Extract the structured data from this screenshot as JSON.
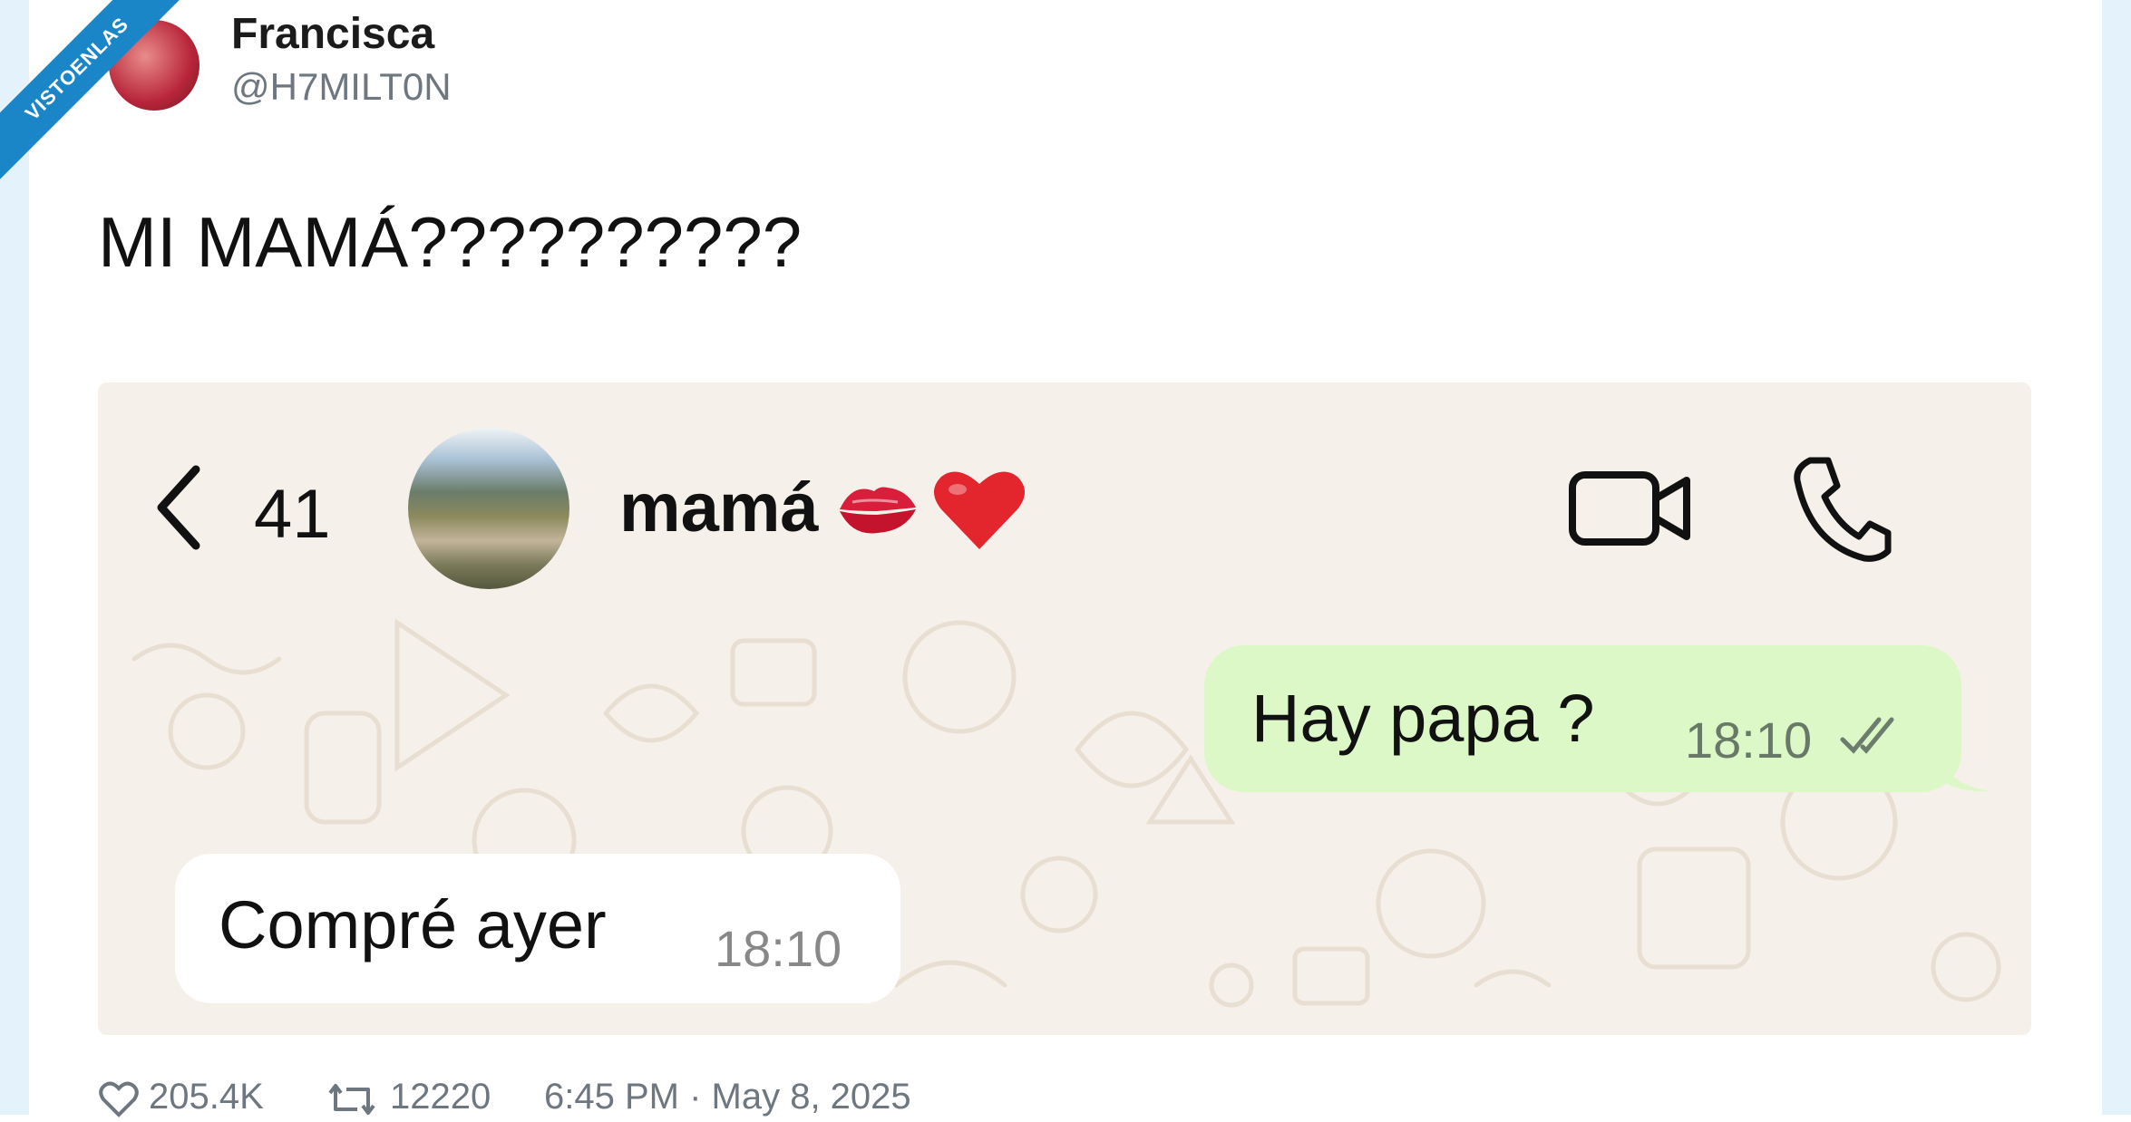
{
  "watermark": "VISTOENLAS",
  "tweet": {
    "author_name": "Francisca",
    "author_handle": "@H7MILT0N",
    "text": "MI MAMÁ??????????"
  },
  "chat": {
    "back_count": "41",
    "contact_name": "mamá",
    "messages": [
      {
        "direction": "outgoing",
        "text": "Hay papa ?",
        "time": "18:10",
        "status": "read"
      },
      {
        "direction": "incoming",
        "text": "Compré ayer",
        "time": "18:10"
      }
    ]
  },
  "footer": {
    "likes": "205.4K",
    "retweets": "12220",
    "timestamp": "6:45 PM · May 8, 2025"
  },
  "colors": {
    "watermark": "#1a86c8",
    "chat_background": "#f5f1ea",
    "outgoing_bubble": "#dcf8c6",
    "incoming_bubble": "#ffffff"
  },
  "icons": [
    "heart-outline-icon",
    "retweet-icon",
    "back-chevron-icon",
    "video-call-icon",
    "phone-icon",
    "kiss-icon",
    "red-heart-icon",
    "double-check-icon"
  ]
}
